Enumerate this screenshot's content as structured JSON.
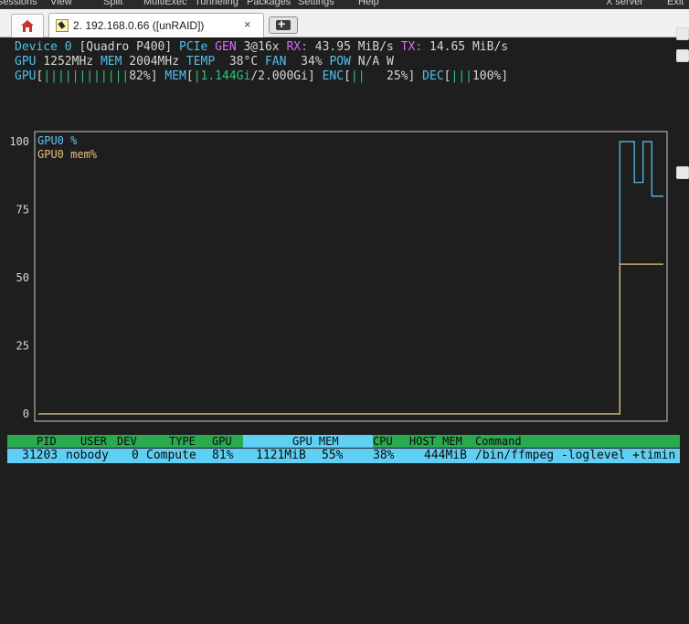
{
  "menubar": {
    "items": [
      "Sessions",
      "View",
      "Split",
      "MultiExec",
      "Tunneling",
      "Packages",
      "Settings",
      "Help",
      "X server",
      "Exit"
    ]
  },
  "tabs": {
    "active_title": "2. 192.168.0.66 ([unRAID])",
    "close_glyph": "×",
    "new_tab_glyph": "+"
  },
  "device": {
    "prefix": "Device 0 ",
    "name": "[Quadro P400]",
    "pcie_label": "PCIe",
    "gen_label": "GEN",
    "gen_value": " 3@16x ",
    "rx_label": "RX:",
    "rx_value": " 43.95 MiB/s ",
    "tx_label": "TX:",
    "tx_value": " 14.65 MiB/s"
  },
  "stats": {
    "gpu_label": "GPU",
    "gpu_clock": " 1252MHz ",
    "mem_label": "MEM",
    "mem_clock": " 2004MHz ",
    "temp_label": "TEMP",
    "temp_value": "  38°C ",
    "fan_label": "FAN",
    "fan_value": "  34% ",
    "pow_label": "POW",
    "pow_value": " N/A W"
  },
  "bars": {
    "gpu_label": "GPU",
    "gpu_open": "[",
    "gpu_fill": "||||||||||||",
    "gpu_value": "82%",
    "gpu_close": "]",
    "mem_label": " MEM",
    "mem_open": "[",
    "mem_fill": "|1.144Gi",
    "mem_value": "/2.000Gi",
    "mem_close": "]",
    "enc_label": " ENC",
    "enc_open": "[",
    "enc_fill": "||",
    "enc_value": "   25%",
    "enc_close": "]",
    "dec_label": " DEC",
    "dec_open": "[",
    "dec_fill": "|||",
    "dec_value": "100%",
    "dec_close": "]"
  },
  "chart_data": {
    "type": "line",
    "ylim": [
      0,
      100
    ],
    "y_ticks": [
      "100",
      "75",
      "50",
      "25",
      "0"
    ],
    "y_tick_values": [
      100,
      75,
      50,
      25,
      0
    ],
    "x": [
      0,
      100,
      199,
      200,
      201,
      202,
      205,
      206,
      207,
      208,
      209,
      210,
      211,
      212,
      213,
      214,
      215
    ],
    "series": [
      {
        "name": "GPU0 %",
        "color": "#5fc8f0",
        "values": [
          0,
          0,
          0,
          100,
          100,
          100,
          85,
          85,
          85,
          100,
          100,
          100,
          80,
          80,
          80,
          80,
          80
        ]
      },
      {
        "name": "GPU0 mem%",
        "color": "#e5c07b",
        "values": [
          0,
          0,
          0,
          55,
          55,
          55,
          55,
          55,
          55,
          55,
          55,
          55,
          55,
          55,
          55,
          55,
          55
        ]
      }
    ]
  },
  "processes": {
    "headers": [
      "PID",
      "USER",
      "DEV",
      "TYPE",
      "GPU",
      "GPU MEM",
      "CPU",
      "HOST MEM",
      "Command"
    ],
    "rows": [
      {
        "pid": "31203",
        "user": "nobody",
        "dev": "0",
        "type": "Compute",
        "gpu": "81%",
        "gpu_mem": "1121MiB",
        "gpu_mem_pct": "55%",
        "cpu": "38%",
        "host_mem": "444MiB",
        "command": "/bin/ffmpeg -loglevel +timin"
      }
    ]
  }
}
